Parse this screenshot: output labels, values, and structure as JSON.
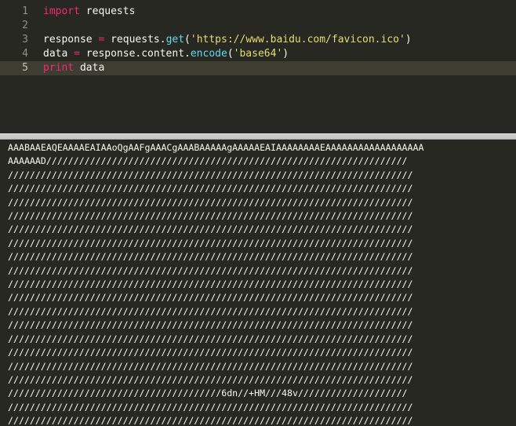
{
  "editor": {
    "lines": [
      {
        "num": "1",
        "parts": [
          {
            "t": "import",
            "c": "kw"
          },
          {
            "t": " requests",
            "c": ""
          }
        ]
      },
      {
        "num": "2",
        "parts": []
      },
      {
        "num": "3",
        "parts": [
          {
            "t": "response ",
            "c": ""
          },
          {
            "t": "=",
            "c": "kw"
          },
          {
            "t": " requests.",
            "c": ""
          },
          {
            "t": "get",
            "c": "fn"
          },
          {
            "t": "(",
            "c": ""
          },
          {
            "t": "'https://www.baidu.com/favicon.ico'",
            "c": "str"
          },
          {
            "t": ")",
            "c": ""
          }
        ]
      },
      {
        "num": "4",
        "parts": [
          {
            "t": "data ",
            "c": ""
          },
          {
            "t": "=",
            "c": "kw"
          },
          {
            "t": " response.content.",
            "c": ""
          },
          {
            "t": "encode",
            "c": "fn"
          },
          {
            "t": "(",
            "c": ""
          },
          {
            "t": "'base64'",
            "c": "str"
          },
          {
            "t": ")",
            "c": ""
          }
        ]
      },
      {
        "num": "5",
        "parts": [
          {
            "t": "print",
            "c": "kw"
          },
          {
            "t": " data",
            "c": ""
          }
        ],
        "active": true
      }
    ]
  },
  "console": {
    "output_lines": [
      "AAABAAEAQEAAAAEAIAAoQgAAFgAAACgAAABAAAAAgAAAAAEAIAAAAAAAAEAAAAAAAAAAAAAAAAAA",
      "AAAAAAD//////////////////////////////////////////////////////////////////",
      "//////////////////////////////////////////////////////////////////////////",
      "//////////////////////////////////////////////////////////////////////////",
      "//////////////////////////////////////////////////////////////////////////",
      "//////////////////////////////////////////////////////////////////////////",
      "//////////////////////////////////////////////////////////////////////////",
      "//////////////////////////////////////////////////////////////////////////",
      "//////////////////////////////////////////////////////////////////////////",
      "//////////////////////////////////////////////////////////////////////////",
      "//////////////////////////////////////////////////////////////////////////",
      "//////////////////////////////////////////////////////////////////////////",
      "//////////////////////////////////////////////////////////////////////////",
      "//////////////////////////////////////////////////////////////////////////",
      "//////////////////////////////////////////////////////////////////////////",
      "//////////////////////////////////////////////////////////////////////////",
      "//////////////////////////////////////////////////////////////////////////",
      "//////////////////////////////////////////////////////////////////////////",
      "///////////////////////////////////////6dn//+HM///48v////////////////////",
      "//////////////////////////////////////////////////////////////////////////",
      "//////////////////////////////////////////////////////////////////////////"
    ]
  }
}
